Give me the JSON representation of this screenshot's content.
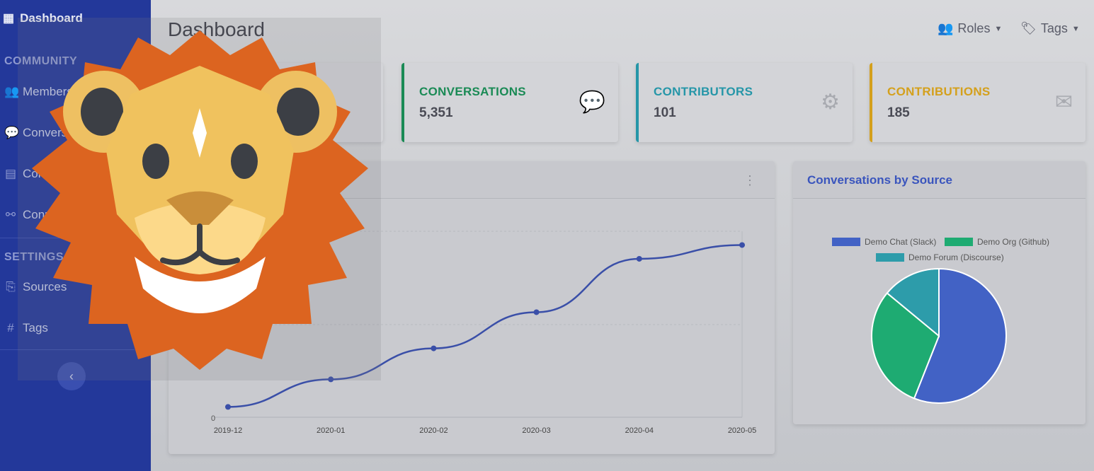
{
  "sidebar": {
    "brand": "Dashboard",
    "section_community": "COMMUNITY",
    "items_community": [
      {
        "label": "Members"
      },
      {
        "label": "Conversations"
      },
      {
        "label": "Contributions"
      },
      {
        "label": "Connections"
      }
    ],
    "section_settings": "SETTINGS",
    "items_settings": [
      {
        "label": "Sources"
      },
      {
        "label": "Tags"
      }
    ]
  },
  "header": {
    "title": "Dashboard",
    "roles_label": "Roles",
    "tags_label": "Tags"
  },
  "cards": [
    {
      "label": "CONVERSATIONS",
      "value": "5,351",
      "color": "#1a8a55"
    },
    {
      "label": "CONTRIBUTORS",
      "value": "101",
      "color": "#2596a8"
    },
    {
      "label": "CONTRIBUTIONS",
      "value": "185",
      "color": "#d4a01c"
    }
  ],
  "pie_panel": {
    "title": "Conversations by Source"
  },
  "chart_data": [
    {
      "type": "line",
      "x": [
        "2019-12",
        "2020-01",
        "2020-02",
        "2020-03",
        "2020-04",
        "2020-05"
      ],
      "series": [
        {
          "values": [
            300,
            1100,
            2000,
            3050,
            4600,
            5000
          ],
          "color": "#3a4fa8"
        }
      ],
      "ylim": [
        0,
        5400
      ],
      "y_ticks": [
        "0"
      ],
      "grid": true
    },
    {
      "type": "pie",
      "series": [
        {
          "name": "Demo Chat (Slack)",
          "values": [
            56
          ],
          "color": "#4262c5"
        },
        {
          "name": "Demo Org (Github)",
          "values": [
            30
          ],
          "color": "#1eab72"
        },
        {
          "name": "Demo Forum (Discourse)",
          "values": [
            14
          ],
          "color": "#2d9caa"
        }
      ],
      "legend": "top"
    }
  ]
}
